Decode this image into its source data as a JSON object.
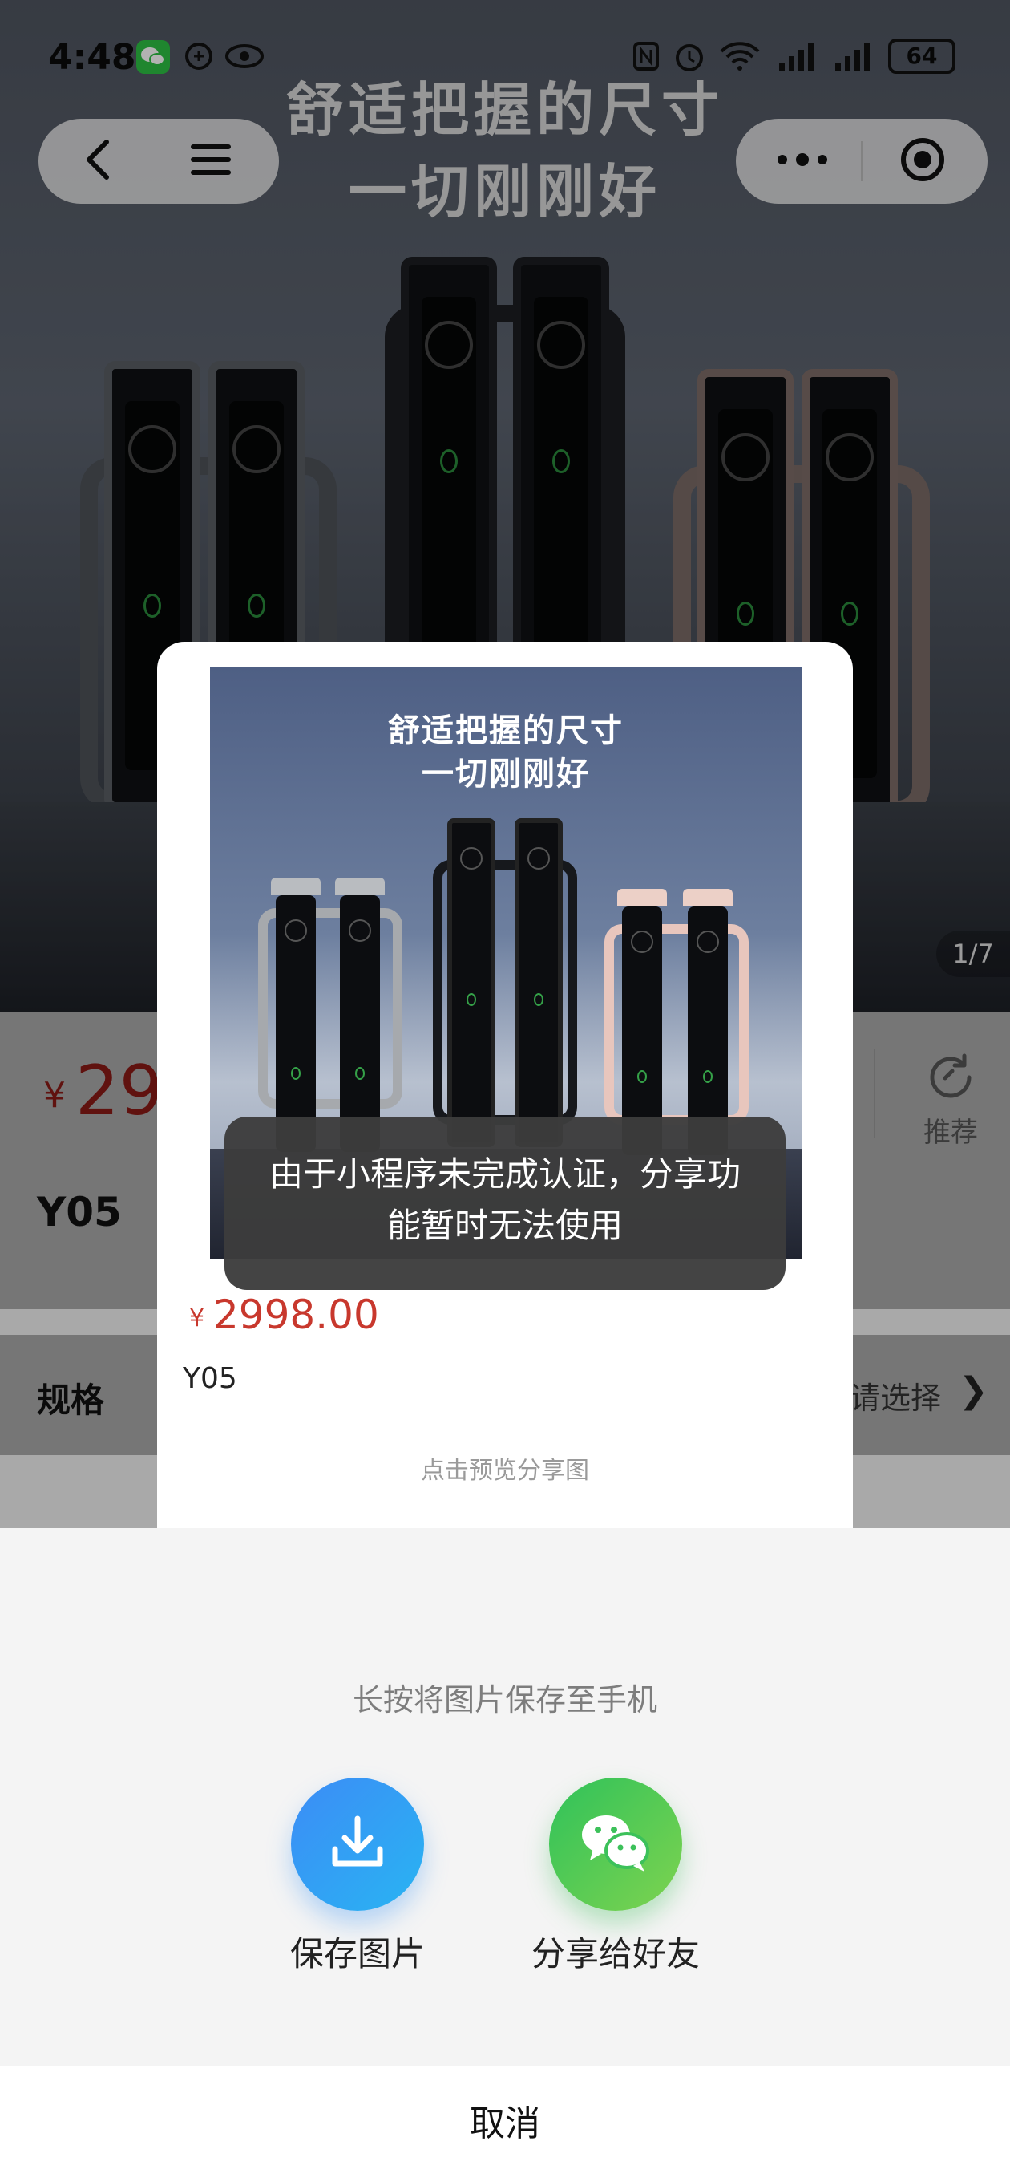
{
  "status_bar": {
    "time": "4:48",
    "battery": "64"
  },
  "capsule": {
    "back_icon": "chevron-left-icon",
    "menu_icon": "hamburger-icon",
    "more_icon": "more-dots-icon",
    "close_icon": "target-circle-icon"
  },
  "hero": {
    "title_line1": "舒适把握的尺寸",
    "title_line2": "一切刚刚好",
    "counter": "1/7"
  },
  "product": {
    "currency": "¥",
    "price_partial": "29",
    "name": "Y05",
    "recommend_label": "推荐",
    "spec_label": "规格",
    "spec_value": "请选择",
    "spec_arrow": "❯"
  },
  "share_card": {
    "poster_title_line1": "舒适把握的尺寸",
    "poster_title_line2": "一切刚刚好",
    "currency": "¥",
    "price": "2998.00",
    "name": "Y05",
    "preview_hint": "点击预览分享图"
  },
  "toast": {
    "message": "由于小程序未完成认证，分享功能暂时无法使用"
  },
  "sheet": {
    "hint": "长按将图片保存至手机",
    "save_label": "保存图片",
    "share_label": "分享给好友",
    "cancel_label": "取消"
  },
  "colors": {
    "price_red": "#c8382d",
    "save_blue": "#3c8cf6",
    "share_green": "#2fc25a",
    "wechat_green": "#2dc144"
  }
}
